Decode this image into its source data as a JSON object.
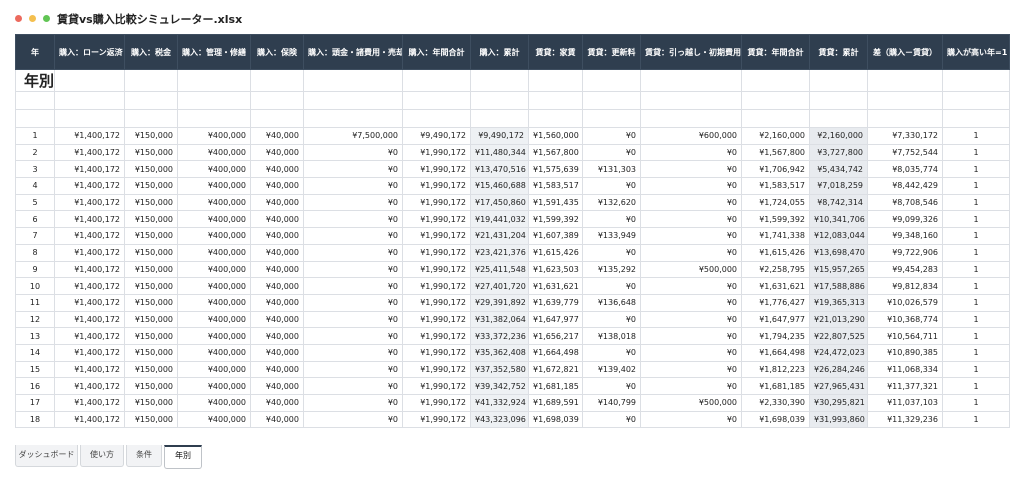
{
  "window": {
    "title": "賃貸vs購入比較シミュレーター.xlsx"
  },
  "sheet": {
    "title": "年別",
    "headers": [
      "年",
      "購入：ローン返済",
      "購入：税金",
      "購入：管理・修繕",
      "購入：保険",
      "購入：頭金・諸費用・売却",
      "購入：年間合計",
      "購入：累計",
      "賃貸：家賃",
      "賃貸：更新料",
      "賃貸：引っ越し・初期費用",
      "賃貸：年間合計",
      "賃貸：累計",
      "差（購入－賃貸）",
      "購入が高い年=1"
    ],
    "rows": [
      [
        "1",
        "¥1,400,172",
        "¥150,000",
        "¥400,000",
        "¥40,000",
        "¥7,500,000",
        "¥9,490,172",
        "¥9,490,172",
        "¥1,560,000",
        "¥0",
        "¥600,000",
        "¥2,160,000",
        "¥2,160,000",
        "¥7,330,172",
        "1"
      ],
      [
        "2",
        "¥1,400,172",
        "¥150,000",
        "¥400,000",
        "¥40,000",
        "¥0",
        "¥1,990,172",
        "¥11,480,344",
        "¥1,567,800",
        "¥0",
        "¥0",
        "¥1,567,800",
        "¥3,727,800",
        "¥7,752,544",
        "1"
      ],
      [
        "3",
        "¥1,400,172",
        "¥150,000",
        "¥400,000",
        "¥40,000",
        "¥0",
        "¥1,990,172",
        "¥13,470,516",
        "¥1,575,639",
        "¥131,303",
        "¥0",
        "¥1,706,942",
        "¥5,434,742",
        "¥8,035,774",
        "1"
      ],
      [
        "4",
        "¥1,400,172",
        "¥150,000",
        "¥400,000",
        "¥40,000",
        "¥0",
        "¥1,990,172",
        "¥15,460,688",
        "¥1,583,517",
        "¥0",
        "¥0",
        "¥1,583,517",
        "¥7,018,259",
        "¥8,442,429",
        "1"
      ],
      [
        "5",
        "¥1,400,172",
        "¥150,000",
        "¥400,000",
        "¥40,000",
        "¥0",
        "¥1,990,172",
        "¥17,450,860",
        "¥1,591,435",
        "¥132,620",
        "¥0",
        "¥1,724,055",
        "¥8,742,314",
        "¥8,708,546",
        "1"
      ],
      [
        "6",
        "¥1,400,172",
        "¥150,000",
        "¥400,000",
        "¥40,000",
        "¥0",
        "¥1,990,172",
        "¥19,441,032",
        "¥1,599,392",
        "¥0",
        "¥0",
        "¥1,599,392",
        "¥10,341,706",
        "¥9,099,326",
        "1"
      ],
      [
        "7",
        "¥1,400,172",
        "¥150,000",
        "¥400,000",
        "¥40,000",
        "¥0",
        "¥1,990,172",
        "¥21,431,204",
        "¥1,607,389",
        "¥133,949",
        "¥0",
        "¥1,741,338",
        "¥12,083,044",
        "¥9,348,160",
        "1"
      ],
      [
        "8",
        "¥1,400,172",
        "¥150,000",
        "¥400,000",
        "¥40,000",
        "¥0",
        "¥1,990,172",
        "¥23,421,376",
        "¥1,615,426",
        "¥0",
        "¥0",
        "¥1,615,426",
        "¥13,698,470",
        "¥9,722,906",
        "1"
      ],
      [
        "9",
        "¥1,400,172",
        "¥150,000",
        "¥400,000",
        "¥40,000",
        "¥0",
        "¥1,990,172",
        "¥25,411,548",
        "¥1,623,503",
        "¥135,292",
        "¥500,000",
        "¥2,258,795",
        "¥15,957,265",
        "¥9,454,283",
        "1"
      ],
      [
        "10",
        "¥1,400,172",
        "¥150,000",
        "¥400,000",
        "¥40,000",
        "¥0",
        "¥1,990,172",
        "¥27,401,720",
        "¥1,631,621",
        "¥0",
        "¥0",
        "¥1,631,621",
        "¥17,588,886",
        "¥9,812,834",
        "1"
      ],
      [
        "11",
        "¥1,400,172",
        "¥150,000",
        "¥400,000",
        "¥40,000",
        "¥0",
        "¥1,990,172",
        "¥29,391,892",
        "¥1,639,779",
        "¥136,648",
        "¥0",
        "¥1,776,427",
        "¥19,365,313",
        "¥10,026,579",
        "1"
      ],
      [
        "12",
        "¥1,400,172",
        "¥150,000",
        "¥400,000",
        "¥40,000",
        "¥0",
        "¥1,990,172",
        "¥31,382,064",
        "¥1,647,977",
        "¥0",
        "¥0",
        "¥1,647,977",
        "¥21,013,290",
        "¥10,368,774",
        "1"
      ],
      [
        "13",
        "¥1,400,172",
        "¥150,000",
        "¥400,000",
        "¥40,000",
        "¥0",
        "¥1,990,172",
        "¥33,372,236",
        "¥1,656,217",
        "¥138,018",
        "¥0",
        "¥1,794,235",
        "¥22,807,525",
        "¥10,564,711",
        "1"
      ],
      [
        "14",
        "¥1,400,172",
        "¥150,000",
        "¥400,000",
        "¥40,000",
        "¥0",
        "¥1,990,172",
        "¥35,362,408",
        "¥1,664,498",
        "¥0",
        "¥0",
        "¥1,664,498",
        "¥24,472,023",
        "¥10,890,385",
        "1"
      ],
      [
        "15",
        "¥1,400,172",
        "¥150,000",
        "¥400,000",
        "¥40,000",
        "¥0",
        "¥1,990,172",
        "¥37,352,580",
        "¥1,672,821",
        "¥139,402",
        "¥0",
        "¥1,812,223",
        "¥26,284,246",
        "¥11,068,334",
        "1"
      ],
      [
        "16",
        "¥1,400,172",
        "¥150,000",
        "¥400,000",
        "¥40,000",
        "¥0",
        "¥1,990,172",
        "¥39,342,752",
        "¥1,681,185",
        "¥0",
        "¥0",
        "¥1,681,185",
        "¥27,965,431",
        "¥11,377,321",
        "1"
      ],
      [
        "17",
        "¥1,400,172",
        "¥150,000",
        "¥400,000",
        "¥40,000",
        "¥0",
        "¥1,990,172",
        "¥41,332,924",
        "¥1,689,591",
        "¥140,799",
        "¥500,000",
        "¥2,330,390",
        "¥30,295,821",
        "¥11,037,103",
        "1"
      ],
      [
        "18",
        "¥1,400,172",
        "¥150,000",
        "¥400,000",
        "¥40,000",
        "¥0",
        "¥1,990,172",
        "¥43,323,096",
        "¥1,698,039",
        "¥0",
        "¥0",
        "¥1,698,039",
        "¥31,993,860",
        "¥11,329,236",
        "1"
      ]
    ]
  },
  "tabs": [
    {
      "label": "ダッシュボード"
    },
    {
      "label": "使い方"
    },
    {
      "label": "条件"
    },
    {
      "label": "年別",
      "active": true
    }
  ],
  "colors": {
    "header_bg": "#2f3e4f",
    "header_text": "#ffffff",
    "grid": "#dcdfe4"
  }
}
